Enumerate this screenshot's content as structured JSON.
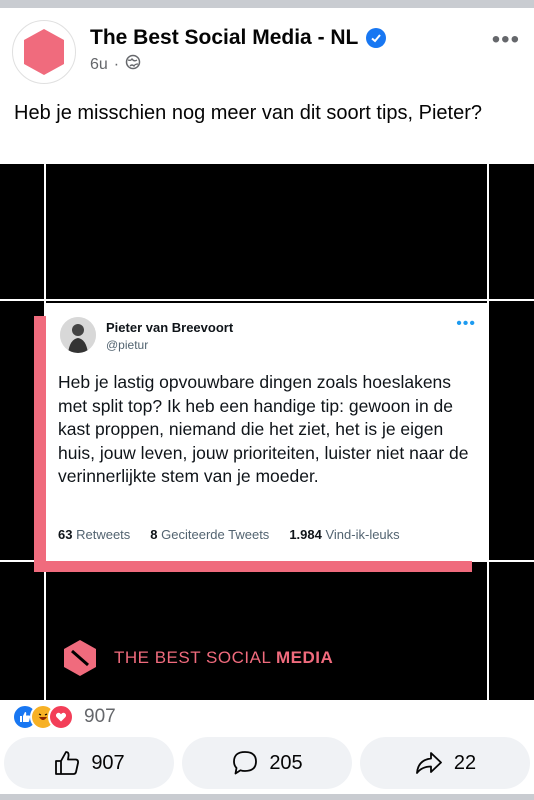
{
  "post": {
    "page_name": "The Best Social Media - NL",
    "time": "6u",
    "separator": "·",
    "text": "Heb je misschien nog meer van dit soort tips, Pieter?",
    "avatar_logo_text": "THE BEST SOCIAL MEDIA"
  },
  "tweet": {
    "name": "Pieter van Breevoort",
    "handle": "@pietur",
    "body": "Heb je lastig opvouwbare dingen zoals hoeslakens met split top? Ik heb een handige tip: gewoon in de kast proppen, niemand die het ziet, het is je eigen huis, jouw leven, jouw prioriteiten, luister niet naar de verinnerlijkte stem van je moeder.",
    "retweets_count": "63",
    "retweets_label": "Retweets",
    "quotes_count": "8",
    "quotes_label": "Geciteerde Tweets",
    "likes_count": "1.984",
    "likes_label": "Vind-ik-leuks"
  },
  "brand": {
    "text_light": "THE BEST SOCIAL ",
    "text_bold": "MEDIA"
  },
  "reactions": {
    "count": "907",
    "icons": [
      "like-icon",
      "haha-icon",
      "love-icon"
    ]
  },
  "actions": {
    "likes": "907",
    "comments": "205",
    "shares": "22"
  },
  "colors": {
    "accent_pink": "#f06b7d",
    "facebook_blue": "#1877f2",
    "twitter_blue": "#1d9bf0"
  }
}
